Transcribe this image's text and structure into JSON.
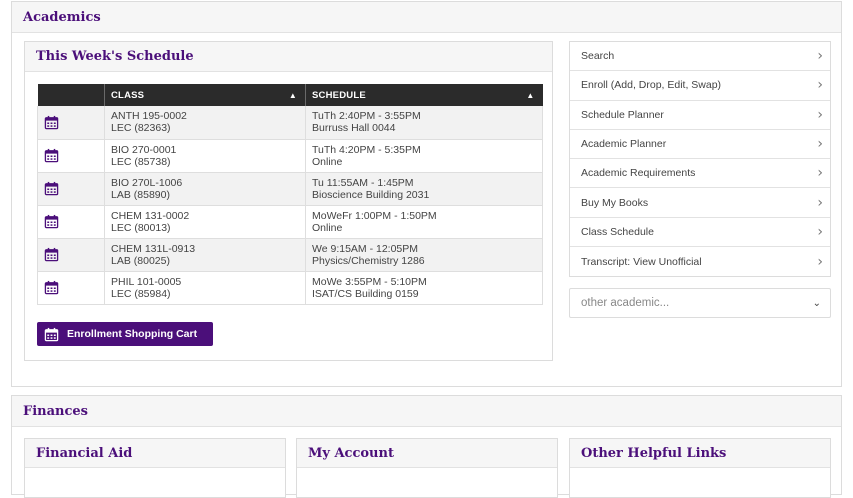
{
  "academics": {
    "title": "Academics",
    "schedule": {
      "title": "This Week's Schedule",
      "columns": [
        "CLASS",
        "SCHEDULE"
      ],
      "rows": [
        {
          "class": "ANTH 195-0002",
          "section": "LEC (82363)",
          "time": "TuTh 2:40PM - 3:55PM",
          "location": "Burruss Hall 0044"
        },
        {
          "class": "BIO 270-0001",
          "section": "LEC (85738)",
          "time": "TuTh 4:20PM - 5:35PM",
          "location": "Online"
        },
        {
          "class": "BIO 270L-1006",
          "section": "LAB (85890)",
          "time": "Tu 11:55AM - 1:45PM",
          "location": "Bioscience Building 2031"
        },
        {
          "class": "CHEM 131-0002",
          "section": "LEC (80013)",
          "time": "MoWeFr 1:00PM - 1:50PM",
          "location": "Online"
        },
        {
          "class": "CHEM 131L-0913",
          "section": "LAB (80025)",
          "time": "We 9:15AM - 12:05PM",
          "location": "Physics/Chemistry 1286"
        },
        {
          "class": "PHIL 101-0005",
          "section": "LEC (85984)",
          "time": "MoWe 3:55PM - 5:10PM",
          "location": "ISAT/CS Building 0159"
        }
      ],
      "cart_button": "Enrollment Shopping Cart"
    },
    "menu": [
      "Search",
      "Enroll (Add, Drop, Edit, Swap)",
      "Schedule Planner",
      "Academic Planner",
      "Academic Requirements",
      "Buy My Books",
      "Class Schedule",
      "Transcript: View Unofficial"
    ],
    "other_select": "other academic..."
  },
  "finances": {
    "title": "Finances",
    "cards": [
      "Financial Aid",
      "My Account",
      "Other Helpful Links"
    ]
  },
  "colors": {
    "accent": "#4b0f7a",
    "table_header": "#2b2b2b"
  },
  "icons": {
    "row_icon": "calendar-icon",
    "menu_icon": "chevron-right-icon",
    "select_icon": "chevron-down-icon"
  }
}
